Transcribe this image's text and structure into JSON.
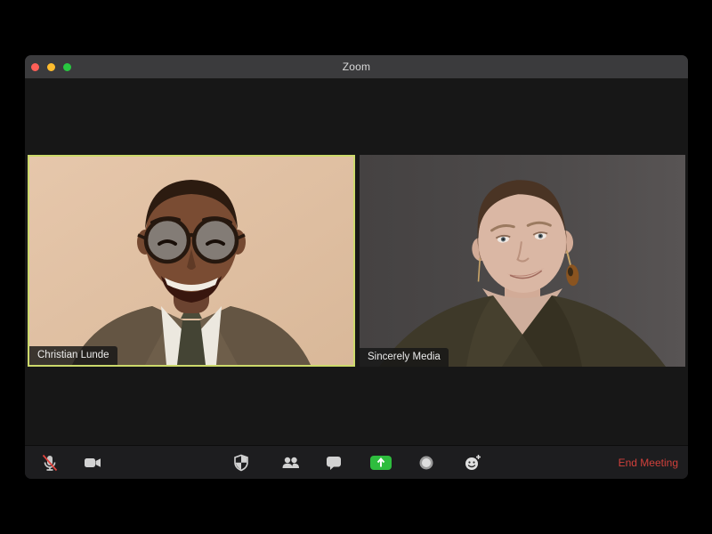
{
  "window": {
    "title": "Zoom"
  },
  "titlebar": {
    "close_color": "#ff5f57",
    "minimize_color": "#febc2e",
    "zoom_color": "#28c840"
  },
  "participants": [
    {
      "name": "Christian Lunde",
      "active_speaker": true
    },
    {
      "name": "Sincerely Media",
      "active_speaker": false
    }
  ],
  "toolbar": {
    "buttons": [
      {
        "id": "mute",
        "icon": "microphone-muted-icon",
        "state": "muted"
      },
      {
        "id": "video",
        "icon": "video-camera-icon"
      },
      {
        "id": "security",
        "icon": "shield-icon"
      },
      {
        "id": "participants",
        "icon": "participants-icon"
      },
      {
        "id": "chat",
        "icon": "chat-bubble-icon"
      },
      {
        "id": "share-screen",
        "icon": "share-screen-up-arrow-icon"
      },
      {
        "id": "record",
        "icon": "record-circle-icon"
      },
      {
        "id": "reactions",
        "icon": "smiley-plus-icon"
      }
    ],
    "end_meeting_label": "End Meeting"
  },
  "colors": {
    "active_speaker_border": "#ccd96b",
    "titlebar_bg": "#3b3b3d",
    "content_bg": "#171717",
    "toolbar_bg": "#1d1d1f",
    "share_green": "#2ebd3e",
    "end_meeting_red": "#d0403b",
    "mute_slash_red": "#e0443e",
    "icon_gray": "#d2d2d2"
  }
}
